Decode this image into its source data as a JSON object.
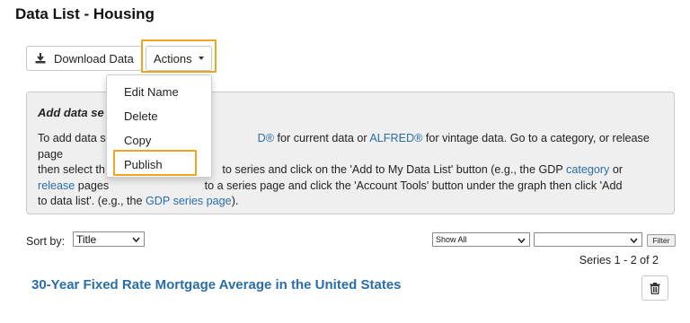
{
  "page": {
    "title": "Data List - Housing"
  },
  "toolbar": {
    "download_label": "Download Data",
    "actions_label": "Actions"
  },
  "actions_menu": {
    "items": [
      {
        "label": "Edit Name"
      },
      {
        "label": "Delete"
      },
      {
        "label": "Copy"
      },
      {
        "label": "Publish"
      }
    ]
  },
  "info_panel": {
    "title_visible": "Add data se",
    "line1_start": "To add data s",
    "line1_link_fred": "D®",
    "line1_mid": " for current data or ",
    "line1_link_alfred": "ALFRED®",
    "line1_end": " for vintage data. Go to a category, or release page",
    "line2_start": "then select th",
    "line2_end": " to series and click on the 'Add to My Data List' button (e.g., the GDP ",
    "line2_link_category": "category",
    "line2_tail": " or",
    "line3_link_release": "release",
    "line3_mid": " pages",
    "line3_end": " to a series page and click the 'Account Tools' button under the graph then click 'Add",
    "line4_start": "to data list'. (e.g., the ",
    "line4_link_gdp": "GDP series page",
    "line4_end": ")."
  },
  "sort": {
    "label": "Sort by:",
    "selected": "Title"
  },
  "filter": {
    "show_selected": "Show All",
    "filter_selected": "",
    "button_label": "Filter"
  },
  "results": {
    "count_text": "Series 1 - 2 of 2"
  },
  "series": [
    {
      "title": "30-Year Fixed Rate Mortgage Average in the United States"
    }
  ],
  "colors": {
    "link": "#2a6ea8",
    "highlight": "#f0a51f",
    "panel_bg": "#efefef"
  },
  "icons": {
    "download": "download-icon",
    "delete": "trash-icon",
    "dropdown": "caret-down-icon"
  }
}
